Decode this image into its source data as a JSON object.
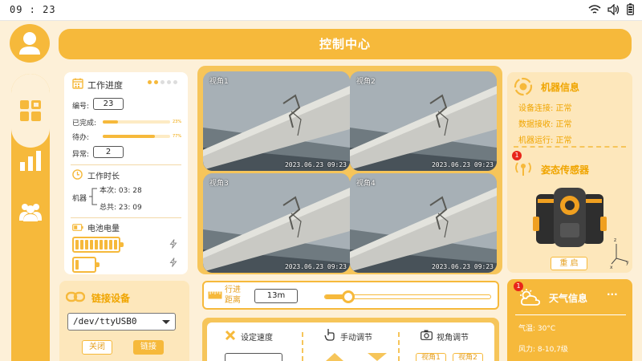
{
  "status": {
    "time": "09 : 23"
  },
  "header": {
    "title": "控制中心"
  },
  "work": {
    "title": "工作进度",
    "id_label": "编号:",
    "id_value": "23",
    "done_label": "已完成:",
    "done_pct": "23%",
    "done_fraction": 0.23,
    "pending_label": "待办:",
    "pending_pct": "77%",
    "pending_fraction": 0.77,
    "error_label": "异常:",
    "error_value": "2",
    "time_title": "工作时长",
    "machine_label": "机器",
    "this_time": "本次: 03: 28",
    "total_time": "总共: 23: 09",
    "battery_title": "电池电量",
    "battery1_cells": 9,
    "battery2_cells": 1
  },
  "link": {
    "title": "链接设备",
    "device": "/dev/ttyUSB0",
    "close_label": "关闭",
    "connect_label": "链接"
  },
  "cameras": [
    {
      "label": "视角1",
      "timestamp": "2023.06.23  09:23"
    },
    {
      "label": "视角2",
      "timestamp": "2023.06.23  09:23"
    },
    {
      "label": "视角3",
      "timestamp": "2023.06.23  09:23"
    },
    {
      "label": "视角4",
      "timestamp": "2023.06.23  09:23"
    }
  ],
  "distance": {
    "label": "行进距离",
    "value": "13m",
    "slider_fraction": 0.14
  },
  "control": {
    "speed_label": "设定速度",
    "manual_label": "手动调节",
    "view_label": "视角调节",
    "view_btn1": "视角1",
    "view_btn2": "视角2"
  },
  "machine": {
    "title": "机器信息",
    "conn": "设备连接: 正常",
    "data": "数据接收: 正常",
    "run": "机器运行: 正常",
    "sensor_title": "姿态传感器",
    "sensor_badge": "1",
    "restart_label": "重 启",
    "axis_z": "z",
    "axis_y": "y",
    "axis_x": "x"
  },
  "weather": {
    "title": "天气信息",
    "badge": "1",
    "more": "···",
    "temp": "气温: 30°C",
    "wind": "风力: 8-10,7级"
  },
  "colors": {
    "accent": "#f6b93b",
    "accent_text": "#f0a500",
    "bg": "#fdf0d8",
    "alert": "#e8261a"
  }
}
